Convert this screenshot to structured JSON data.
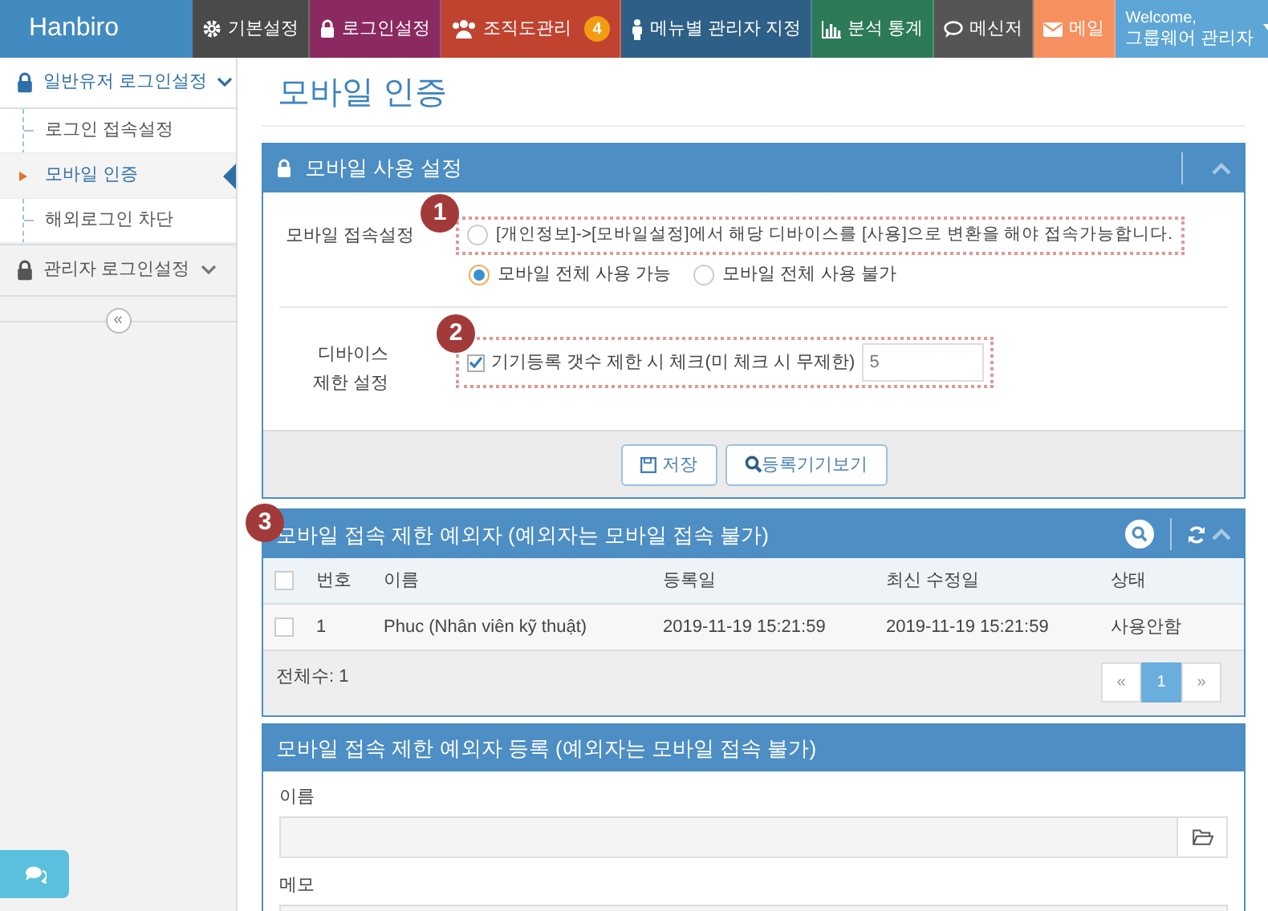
{
  "nav": {
    "logo": "Hanbiro",
    "tabs": [
      {
        "label": "기본설정",
        "color": "#4a4a4a"
      },
      {
        "label": "로그인설정",
        "color": "#8b2a60"
      },
      {
        "label": "조직도관리",
        "color": "#c0432f",
        "badge": "4"
      },
      {
        "label": "메뉴별 관리자 지정",
        "color": "#2e5f86"
      },
      {
        "label": "분석 통계",
        "color": "#2c7a56"
      },
      {
        "label": "메신저",
        "color": "#555555"
      },
      {
        "label": "메일",
        "color": "#f6905e"
      }
    ],
    "user": {
      "greeting": "Welcome,",
      "name": "그룹웨어 관리자"
    }
  },
  "sidebar": {
    "groups": [
      {
        "label": "일반유저 로그인설정",
        "expanded": true,
        "children": [
          {
            "label": "로그인 접속설정",
            "selected": false
          },
          {
            "label": "모바일 인증",
            "selected": true
          },
          {
            "label": "해외로그인 차단",
            "selected": false
          }
        ]
      },
      {
        "label": "관리자 로그인설정",
        "expanded": false
      }
    ],
    "collapse": "«"
  },
  "page_title": "모바일 인증",
  "settings_panel": {
    "title": "모바일 사용 설정",
    "access": {
      "label": "모바일 접속설정",
      "marker": "1",
      "options": [
        {
          "label": "[개인정보]->[모바일설정]에서 해당 디바이스를 [사용]으로 변환을 해야 접속가능합니다.",
          "selected": false
        },
        {
          "label": "모바일 전체 사용 가능",
          "selected": true
        },
        {
          "label": "모바일 전체 사용 불가",
          "selected": false
        }
      ]
    },
    "device": {
      "label": "디바이스 제한 설정",
      "marker": "2",
      "checkbox": {
        "label": "기기등록 갯수 제한 시 체크(미 체크 시 무제한)",
        "checked": true
      },
      "value": "5"
    },
    "buttons": [
      "저장",
      "등록기기보기"
    ]
  },
  "exceptions_panel": {
    "title": "모바일 접속 제한 예외자 (예외자는 모바일 접속 불가)",
    "marker": "3",
    "select_all_checked": false,
    "columns": [
      "번호",
      "이름",
      "등록일",
      "최신 수정일",
      "상태"
    ],
    "rows": [
      {
        "checked": false,
        "cells": [
          "1",
          "Phuc (Nhân viên kỹ thuật)",
          "2019-11-19 15:21:59",
          "2019-11-19 15:21:59",
          "사용안함"
        ]
      }
    ],
    "total": "전체수: 1",
    "pages": [
      {
        "label": "«",
        "selected": false
      },
      {
        "label": "1",
        "selected": true
      },
      {
        "label": "»",
        "selected": false
      }
    ]
  },
  "register_panel": {
    "title": "모바일 접속 제한 예외자 등록 (예외자는 모바일 접속 불가)",
    "fields": [
      {
        "label": "이름"
      },
      {
        "label": "메모"
      }
    ]
  }
}
